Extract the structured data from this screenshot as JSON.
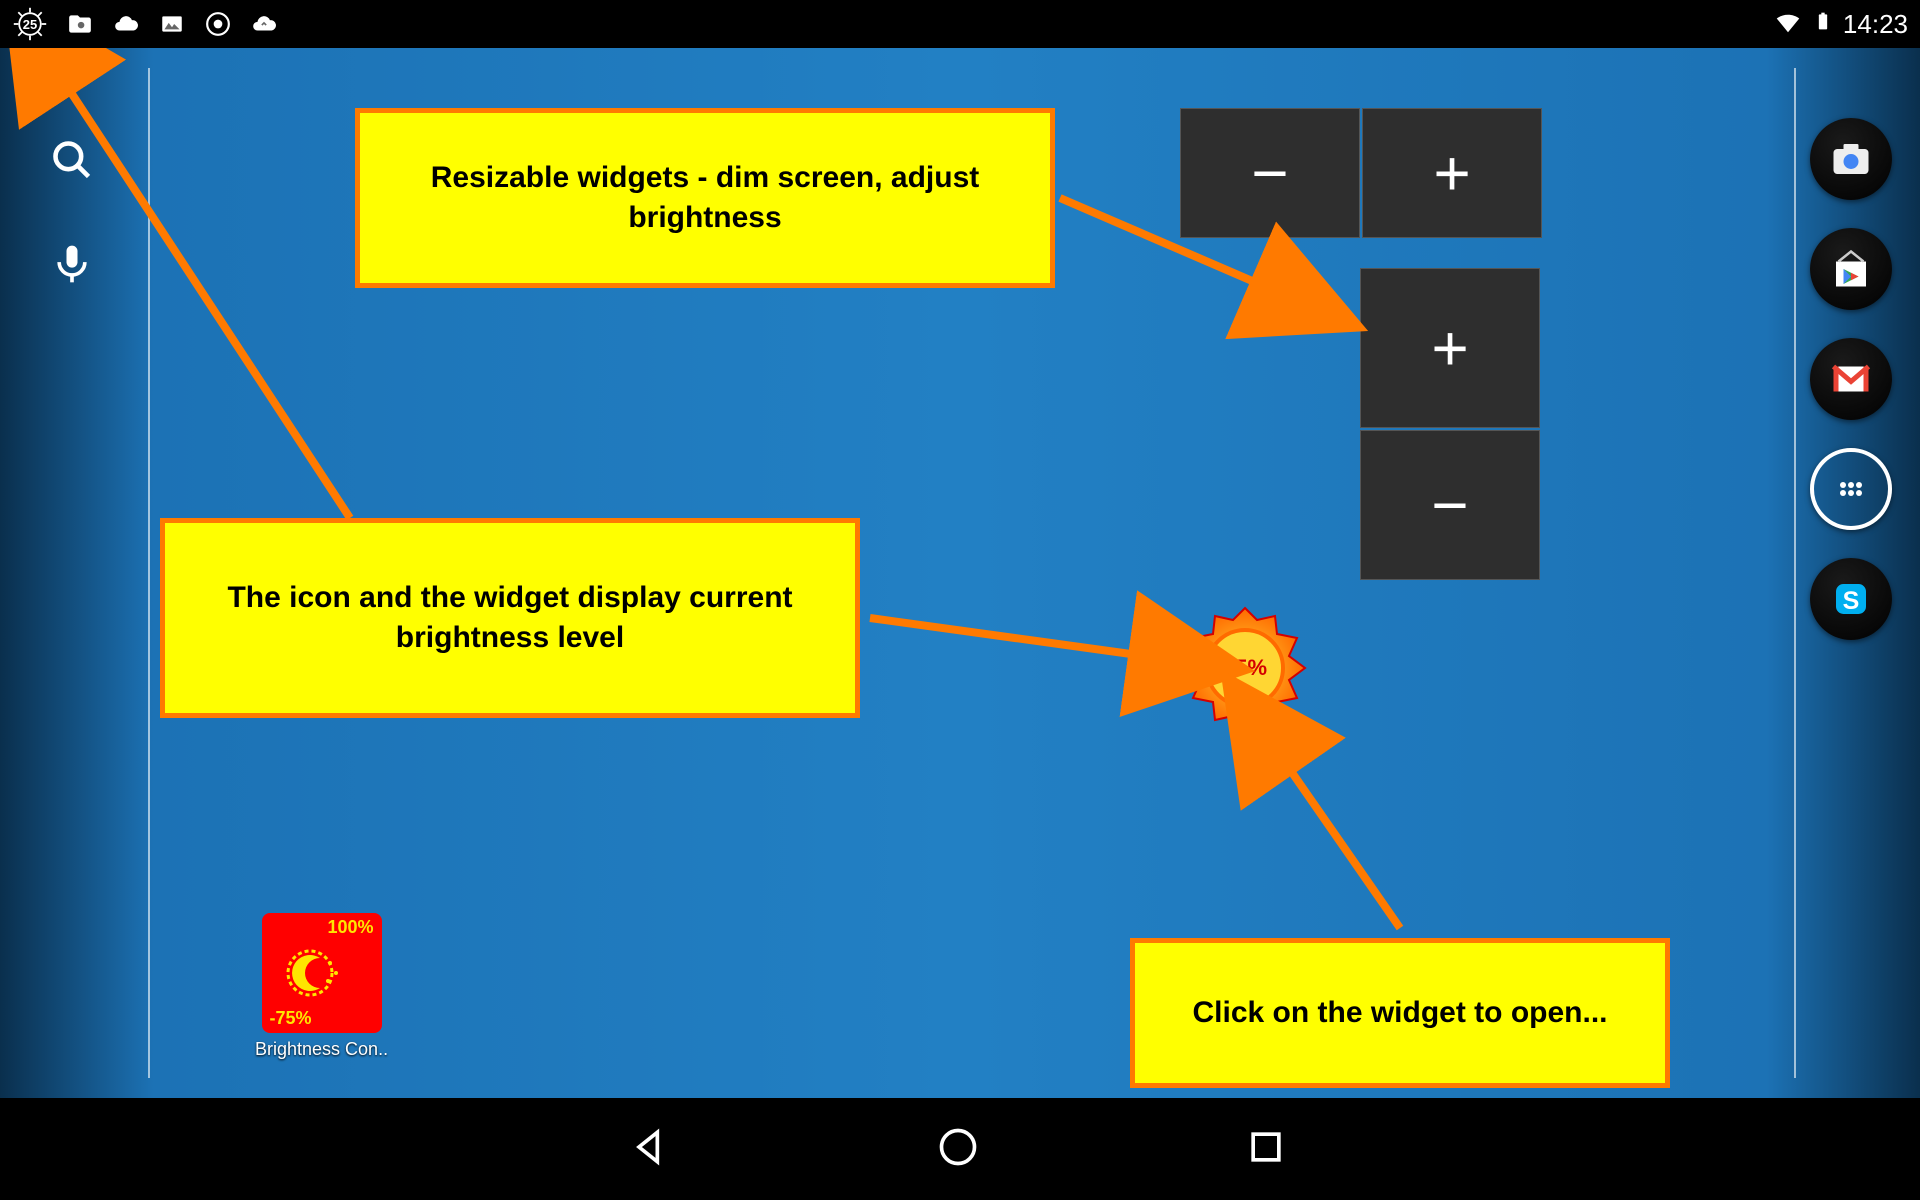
{
  "status_bar": {
    "gear_value": "25",
    "time": "14:23"
  },
  "callouts": {
    "c1": "Resizable widgets - dim screen, adjust brightness",
    "c2": "The icon and the widget display current brightness level",
    "c3": "Click on the widget to open..."
  },
  "widgets": {
    "minus": "−",
    "plus": "+",
    "plus2": "+",
    "minus2": "−",
    "sun_value": "25%"
  },
  "app": {
    "top_label": "100%",
    "bottom_label": "-75%",
    "name": "Brightness Con.."
  },
  "dock": {
    "apps_label": "apps-drawer"
  }
}
